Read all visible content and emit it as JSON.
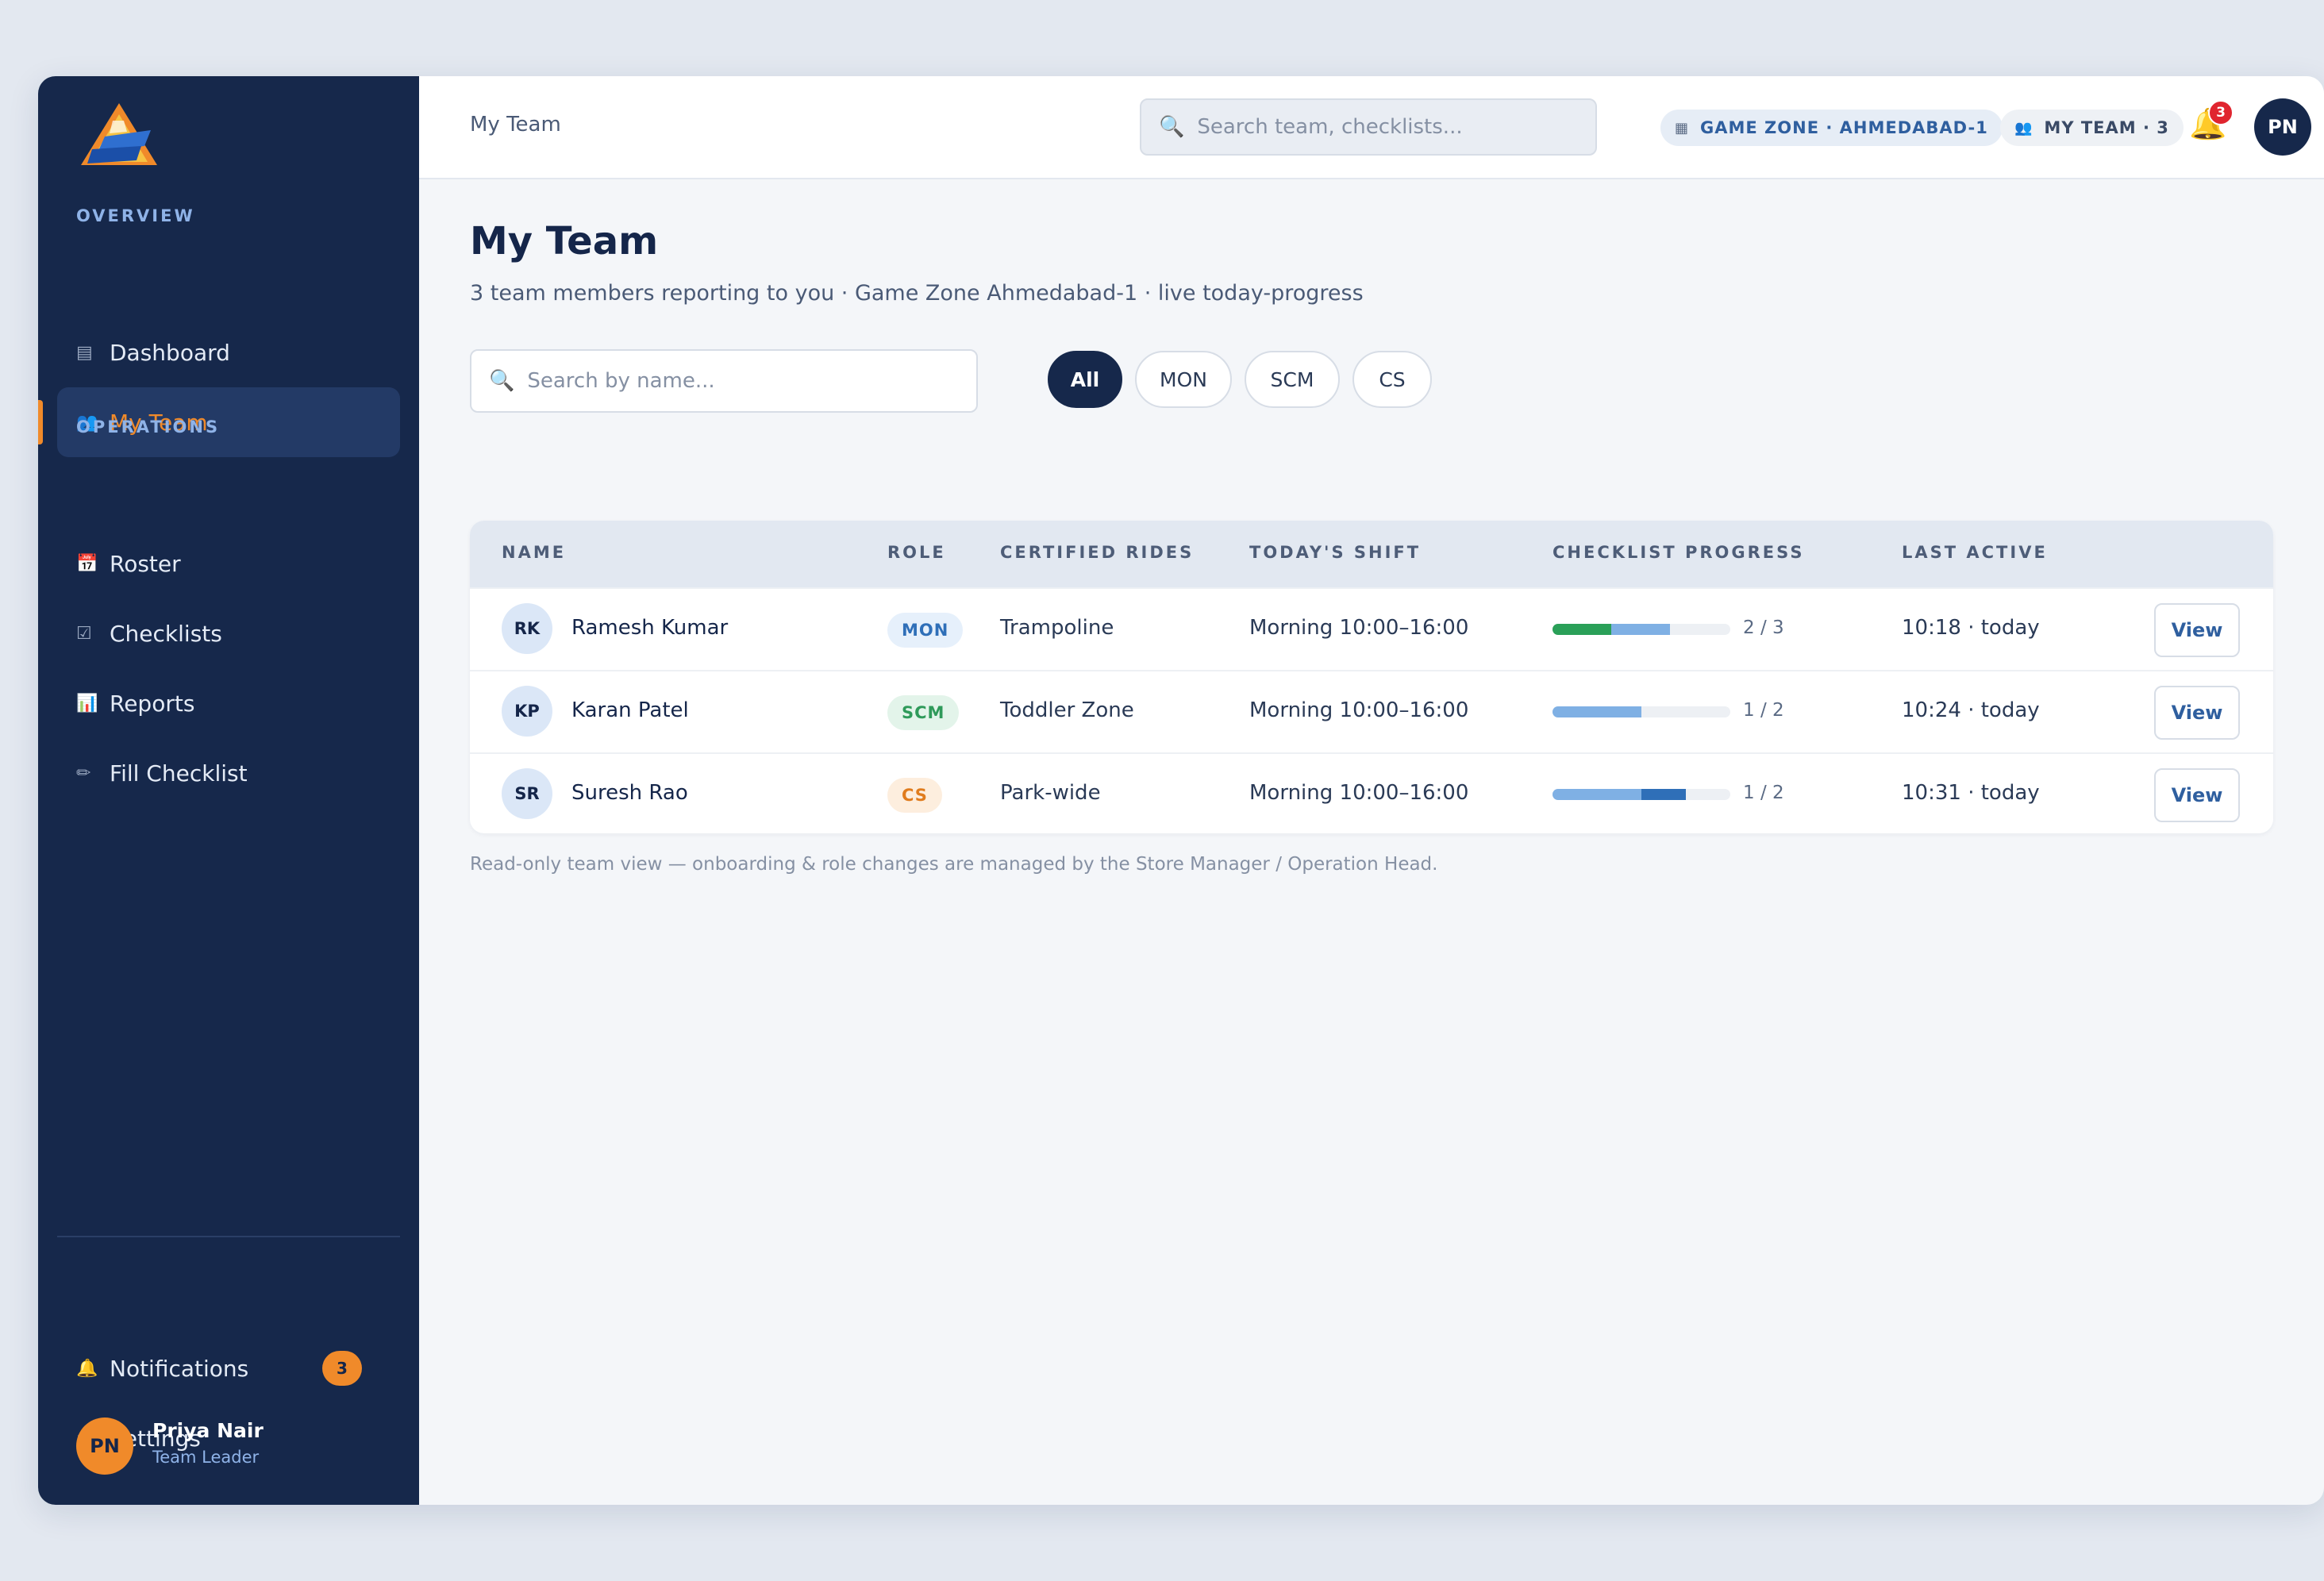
{
  "brand": {
    "logo_icon": "game-zone-logo"
  },
  "sidebar": {
    "sections": [
      {
        "label": "OVERVIEW"
      },
      {
        "label": "OPERATIONS"
      }
    ],
    "items": [
      {
        "label": "Dashboard",
        "icon": "dashboard-icon",
        "glyph": "▤",
        "active": false
      },
      {
        "label": "My Team",
        "icon": "team-icon",
        "glyph": "👥",
        "active": true
      },
      {
        "label": "Roster",
        "icon": "calendar-icon",
        "glyph": "📅",
        "active": false
      },
      {
        "label": "Checklists",
        "icon": "checkbox-icon",
        "glyph": "☑",
        "active": false
      },
      {
        "label": "Reports",
        "icon": "chart-icon",
        "glyph": "📊",
        "active": false
      },
      {
        "label": "Fill Checklist",
        "icon": "pencil-icon",
        "glyph": "✏",
        "active": false
      }
    ],
    "bottom": {
      "notifications": {
        "label": "Notifications",
        "icon": "bell-icon",
        "glyph": "🔔",
        "count": "3"
      },
      "settings": {
        "label": "Settings",
        "icon": "gear-icon",
        "glyph": "⚙"
      }
    },
    "profile": {
      "initials": "PN",
      "name": "Priya Nair",
      "role": "Team Leader"
    }
  },
  "topbar": {
    "breadcrumb": "My Team",
    "search": {
      "placeholder": "Search team, checklists..."
    },
    "location_chip": {
      "icon": "building-icon",
      "label": "GAME ZONE · AHMEDABAD-1"
    },
    "team_chip": {
      "icon": "team-icon",
      "label": "MY TEAM · 3"
    },
    "notifications": {
      "count": "3"
    },
    "avatar_initials": "PN"
  },
  "main": {
    "title": "My Team",
    "subtitle": "3 team members reporting to you · Game Zone Ahmedabad-1 · live today-progress",
    "search": {
      "placeholder": "Search by name..."
    },
    "filters": [
      {
        "label": "All",
        "active": true
      },
      {
        "label": "MON",
        "active": false
      },
      {
        "label": "SCM",
        "active": false
      },
      {
        "label": "CS",
        "active": false
      }
    ],
    "table": {
      "columns": [
        "NAME",
        "ROLE",
        "CERTIFIED RIDES",
        "TODAY'S SHIFT",
        "CHECKLIST PROGRESS",
        "LAST ACTIVE"
      ],
      "rows": [
        {
          "initials": "RK",
          "name": "Ramesh Kumar",
          "role": "MON",
          "rides": "Trampoline",
          "shift": "Morning 10:00–16:00",
          "progress_label": "2 / 3",
          "progress": [
            0.33,
            0.33
          ],
          "last_active": "10:18 · today",
          "action": "View"
        },
        {
          "initials": "KP",
          "name": "Karan Patel",
          "role": "SCM",
          "rides": "Toddler Zone",
          "shift": "Morning 10:00–16:00",
          "progress_label": "1 / 2",
          "progress": [
            0.5
          ],
          "last_active": "10:24 · today",
          "action": "View"
        },
        {
          "initials": "SR",
          "name": "Suresh Rao",
          "role": "CS",
          "rides": "Park-wide",
          "shift": "Morning 10:00–16:00",
          "progress_label": "1 / 2",
          "progress": [
            0.5,
            0.25
          ],
          "last_active": "10:31 · today",
          "action": "View"
        }
      ]
    },
    "footnote": "Read-only team view — onboarding & role changes are managed by the Store Manager / Operation Head."
  },
  "colors": {
    "sidebar_bg": "#16284b",
    "accent_orange": "#f08a2a",
    "role_mon": "#2f6fb8",
    "role_scm": "#2f9a5a",
    "role_cs": "#e07c1e",
    "progress_green": "#2aa058",
    "progress_light": "#7fb0e4",
    "progress_dark": "#2f6fb8"
  }
}
